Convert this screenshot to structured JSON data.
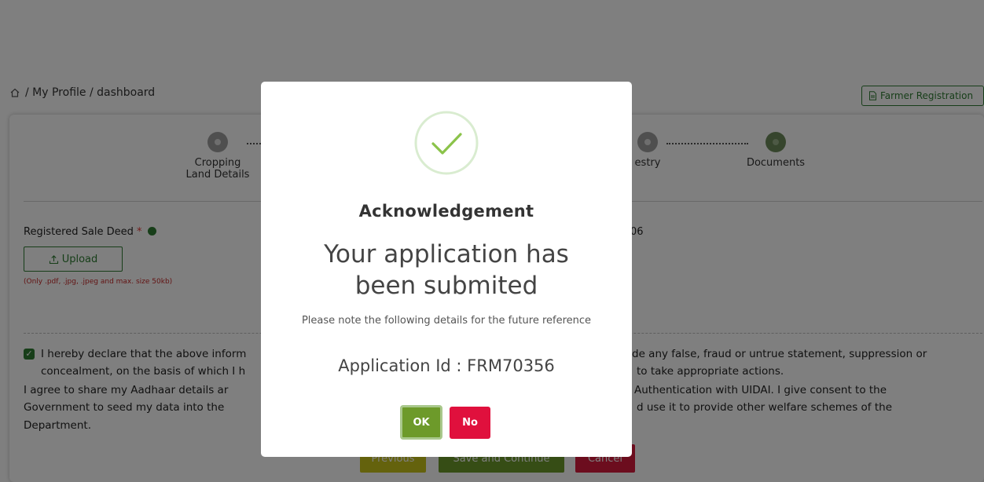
{
  "breadcrumb": {
    "text": "/ My Profile / dashboard"
  },
  "header": {
    "farmer_registration_label": "Farmer Registration"
  },
  "stepper": {
    "steps": [
      {
        "label_line1": "Cropping",
        "label_line2": "Land Details"
      },
      {
        "label_line1": "estry",
        "label_line2": ""
      },
      {
        "label_line1": "Documents",
        "label_line2": ""
      }
    ]
  },
  "form": {
    "registered_sale_deed_label": "Registered Sale Deed",
    "required_mark": "*",
    "upload_label": "Upload",
    "upload_hint": "(Only .pdf, .jpg, .jpeg and max. size 50kb)",
    "partial_right_value": "06"
  },
  "declaration": {
    "checked": true,
    "line1_left": "I hereby declare that the above inform",
    "line1_right": "de any false, fraud or untrue statement, suppression or",
    "line2_left": "concealment, on the basis of which I h",
    "line2_right": "to take appropriate actions.",
    "line3_left": "I agree to share my Aadhaar details ar",
    "line3_right": "Authentication with UIDAI. I give consent to the",
    "line4_left": "Government to seed my data into the",
    "line4_right": "d use it to provide other welfare schemes of the",
    "line5_left": "Department."
  },
  "actions": {
    "previous_label": "Previous",
    "save_label": "Save and Continue",
    "cancel_label": "Cancel"
  },
  "modal": {
    "title": "Acknowledgement",
    "message_line1": "Your application has",
    "message_line2": "been submited",
    "note": "Please note the following details for the future reference",
    "application_id_text": "Application Id : FRM70356",
    "ok_label": "OK",
    "no_label": "No"
  },
  "colors": {
    "accent_green": "#2e7d32",
    "ok_green": "#6d9a2a",
    "no_red": "#e0103d",
    "previous_yellow": "#c9c41a",
    "cancel_red": "#d81b3d"
  },
  "icons": {
    "home": "home-icon",
    "document": "document-icon",
    "upload": "upload-icon",
    "info": "info-icon",
    "check": "checkmark-circle-icon"
  }
}
